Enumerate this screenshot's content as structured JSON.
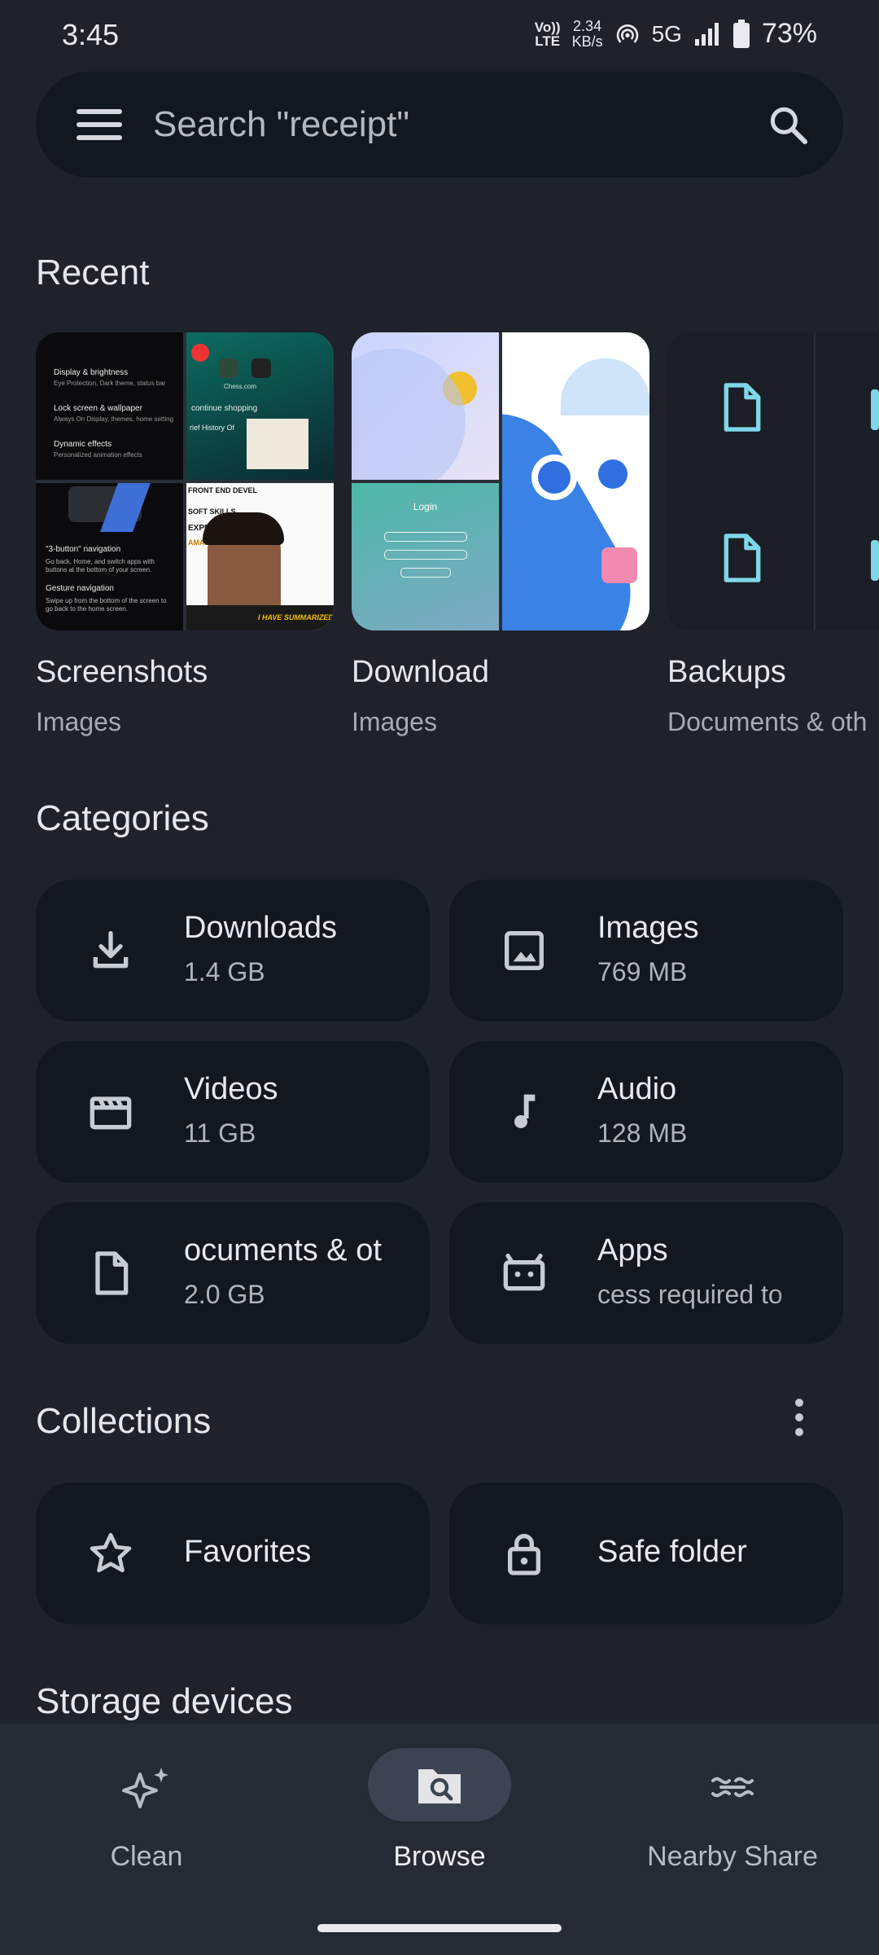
{
  "status": {
    "time": "3:45",
    "volte_top": "Vo))",
    "volte_bottom": "LTE",
    "speed_value": "2.34",
    "speed_unit": "KB/s",
    "network": "5G",
    "battery": "73%"
  },
  "search": {
    "placeholder": "Search \"receipt\""
  },
  "recent": {
    "title": "Recent",
    "items": [
      {
        "label": "Screenshots",
        "sub": "Images"
      },
      {
        "label": "Download",
        "sub": "Images"
      },
      {
        "label": "Backups",
        "sub": "Documents & oth"
      }
    ],
    "thumb_text": {
      "display_brightness": "Display & brightness",
      "display_sub": "Eye Protection, Dark theme, status bar",
      "lock_screen": "Lock screen & wallpaper",
      "lock_sub": "Always On Display, themes, home setting",
      "dynamic": "Dynamic effects",
      "dynamic_sub": "Personalized animation effects",
      "three_button": "\"3-button\" navigation",
      "three_sub": "Go back, Home, and switch apps with buttons at the bottom of your screen.",
      "gesture": "Gesture navigation",
      "gesture_sub": "Swipe up from the bottom of the screen to go back to the home screen.",
      "continue": "continue shopping",
      "chess": "Chess.com",
      "history": "rief History Of",
      "front_end": "FRONT END DEVEL",
      "soft_skills": "SOFT SKILLS",
      "experience": "EXPERIE",
      "amazon": "AMAZON",
      "summarized": "I HAVE SUMMARIZED",
      "login": "Login"
    }
  },
  "categories": {
    "title": "Categories",
    "items": [
      {
        "name": "Downloads",
        "size": "1.4 GB",
        "icon": "download-icon"
      },
      {
        "name": "Images",
        "size": "769 MB",
        "icon": "image-icon"
      },
      {
        "name": "Videos",
        "size": "11 GB",
        "icon": "video-icon"
      },
      {
        "name": "Audio",
        "size": "128 MB",
        "icon": "music-note-icon"
      },
      {
        "name": "ocuments & ot",
        "size": "2.0 GB",
        "icon": "document-icon"
      },
      {
        "name": "Apps",
        "size": "cess required to",
        "icon": "android-icon"
      }
    ]
  },
  "collections": {
    "title": "Collections",
    "items": [
      {
        "name": "Favorites",
        "icon": "star-icon"
      },
      {
        "name": "Safe folder",
        "icon": "lock-icon"
      }
    ]
  },
  "storage": {
    "title": "Storage devices"
  },
  "nav": {
    "items": [
      {
        "label": "Clean",
        "icon": "sparkle-icon"
      },
      {
        "label": "Browse",
        "icon": "folder-search-icon",
        "active": true
      },
      {
        "label": "Nearby Share",
        "icon": "nearby-share-icon"
      }
    ]
  },
  "colors": {
    "background": "#1f222b",
    "card": "#131720",
    "accent_cyan": "#7ed6e8",
    "nav_background": "#262a35",
    "nav_active_pill": "#3d4352"
  }
}
